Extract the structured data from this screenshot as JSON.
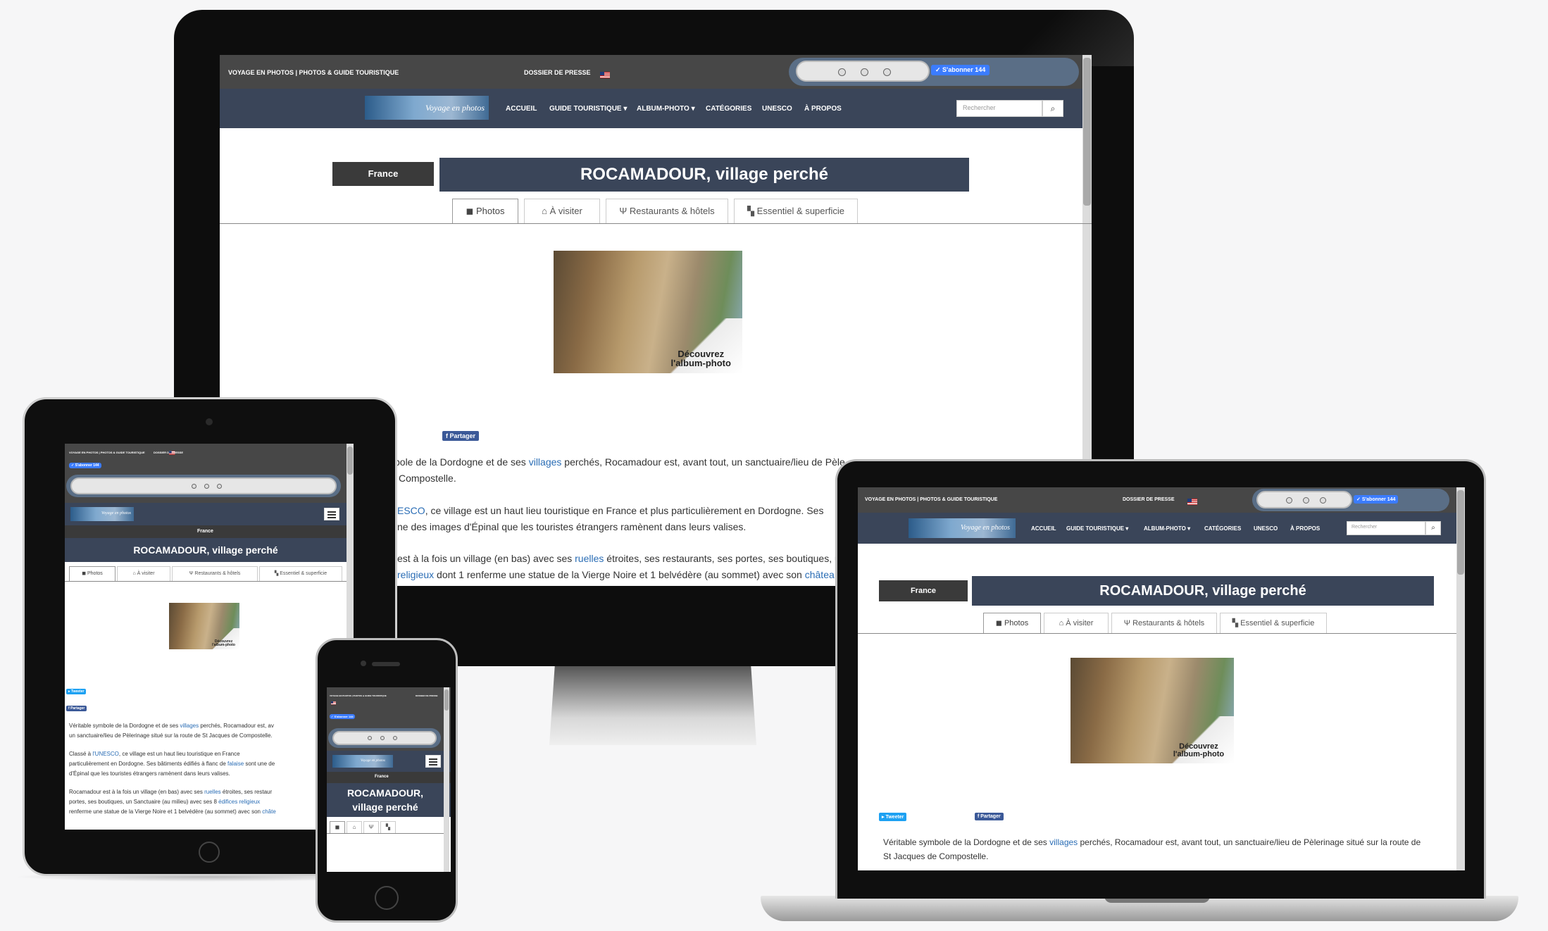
{
  "site": {
    "topbar_title": "VOYAGE EN PHOTOS | PHOTOS & GUIDE TOURISTIQUE",
    "press": "DOSSIER DE PRESSE",
    "subscribe": "S'abonner 144",
    "brand": "Voyage en photos",
    "nav": [
      "ACCUEIL",
      "GUIDE TOURISTIQUE ▾",
      "ALBUM-PHOTO ▾",
      "CATÉGORIES",
      "UNESCO",
      "À PROPOS"
    ],
    "search_placeholder": "Rechercher",
    "country": "France",
    "title": "ROCAMADOUR, village perché",
    "tabs": [
      "Photos",
      "À visiter",
      "Restaurants & hôtels",
      "Essentiel & superficie"
    ],
    "photo_caption_1": "Découvrez",
    "photo_caption_2": "l'album-photo",
    "tweet": "Tweeter",
    "share": "Partager",
    "monitor_text": {
      "l1a": "bole de la Dordogne et de ses ",
      "l1link": "villages",
      "l1b": " perchés, Rocamadour est, avant tout, un sanctuaire/lieu de Pèle",
      "l2": "Compostelle.",
      "l3link": "ESCO",
      "l3": ", ce village est un haut lieu touristique en France et plus particulièrement en Dordogne. Ses",
      "l4": "ne des images d'Épinal que les touristes étrangers ramènent dans leurs valises.",
      "l5a": "est à la fois un village (en bas) avec ses ",
      "l5link": "ruelles",
      "l5b": " étroites, ses restaurants, ses portes, ses boutiques, u",
      "l6link": "religieux",
      "l6b": " dont 1 renferme une statue de la Vierge Noire et 1 belvédère (au sommet) avec son ",
      "l6link2": "châtea"
    },
    "laptop_text": {
      "l1a": "Véritable symbole de la Dordogne et de ses ",
      "l1link": "villages",
      "l1b": " perchés, Rocamadour est, avant tout, un sanctuaire/lieu de Pèlerinage situé sur la route de",
      "l2": "St Jacques de Compostelle."
    },
    "tablet_text": {
      "p1a": "Véritable symbole de la Dordogne et de ses ",
      "p1link": "villages",
      "p1b": " perchés, Rocamadour est, av",
      "p1c": "un sanctuaire/lieu de Pèlerinage situé sur la route de St Jacques de Compostelle.",
      "p2a": "Classé à ",
      "p2link": "l'UNESCO",
      "p2b": ", ce village est un haut lieu touristique en France",
      "p2c": "particulièrement en Dordogne. Ses bâtiments édifiés à flanc de ",
      "p2link2": "falaise",
      "p2d": " sont une de",
      "p2e": "d'Épinal que les touristes étrangers ramènent dans leurs valises.",
      "p3a": "Rocamadour est à la fois un village (en bas) avec ses ",
      "p3link": "ruelles",
      "p3b": " étroites, ses restaur",
      "p3c": "portes, ses boutiques, un Sanctuaire (au milieu) avec ses 8 ",
      "p3link2": "édifices religieux",
      "p3d": "renferme une statue de la Vierge Noire et 1 belvédère (au sommet) avec son ",
      "p3link3": "châte"
    },
    "phone_title_1": "ROCAMADOUR,",
    "phone_title_2": "village perché"
  }
}
